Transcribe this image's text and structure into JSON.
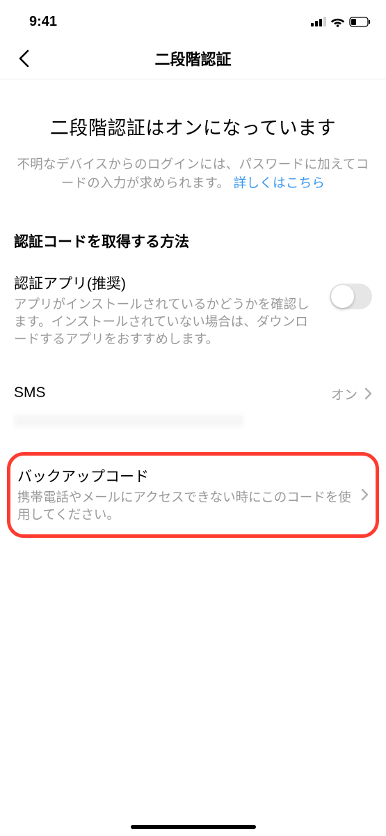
{
  "statusBar": {
    "time": "9:41"
  },
  "header": {
    "title": "二段階認証"
  },
  "hero": {
    "title": "二段階認証はオンになっています",
    "desc": "不明なデバイスからのログインには、パスワードに加えてコードの入力が求められます。 ",
    "link": "詳しくはこちら"
  },
  "sectionTitle": "認証コードを取得する方法",
  "authApp": {
    "title": "認証アプリ(推奨)",
    "desc": "アプリがインストールされているかどうかを確認します。インストールされていない場合は、ダウンロードするアプリをおすすめします。"
  },
  "sms": {
    "title": "SMS",
    "status": "オン"
  },
  "backup": {
    "title": "バックアップコード",
    "desc": "携帯電話やメールにアクセスできない時にこのコードを使用してください。"
  }
}
